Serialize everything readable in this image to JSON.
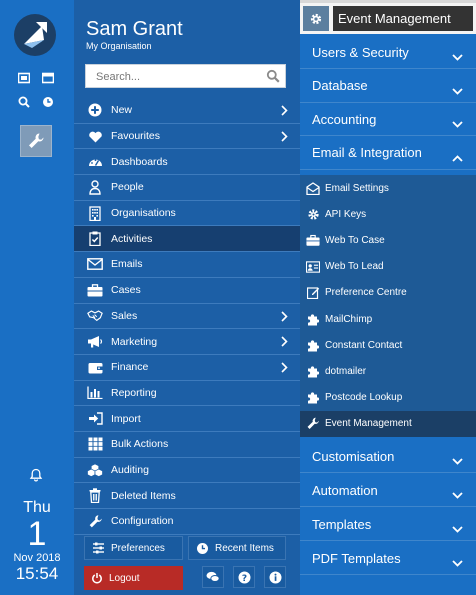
{
  "rail": {
    "icons": [
      "logo-icon",
      "card-icon",
      "window-icon",
      "search-icon",
      "history-icon",
      "wrench-icon",
      "bell-icon"
    ],
    "date": {
      "weekday": "Thu",
      "day": "1",
      "month_year": "Nov 2018",
      "time": "15:54"
    }
  },
  "user": {
    "name": "Sam Grant",
    "organisation": "My Organisation"
  },
  "search": {
    "placeholder": "Search..."
  },
  "menu": [
    {
      "label": "New",
      "icon": "plus-circle-icon",
      "chevron": true
    },
    {
      "label": "Favourites",
      "icon": "heart-icon",
      "chevron": true
    },
    {
      "label": "Dashboards",
      "icon": "dashboard-icon",
      "chevron": false
    },
    {
      "label": "People",
      "icon": "person-icon",
      "chevron": false
    },
    {
      "label": "Organisations",
      "icon": "building-icon",
      "chevron": false
    },
    {
      "label": "Activities",
      "icon": "clipboard-check-icon",
      "chevron": false,
      "active": true
    },
    {
      "label": "Emails",
      "icon": "envelope-icon",
      "chevron": false
    },
    {
      "label": "Cases",
      "icon": "briefcase-icon",
      "chevron": false
    },
    {
      "label": "Sales",
      "icon": "handshake-icon",
      "chevron": true
    },
    {
      "label": "Marketing",
      "icon": "megaphone-icon",
      "chevron": true
    },
    {
      "label": "Finance",
      "icon": "wallet-icon",
      "chevron": true
    },
    {
      "label": "Reporting",
      "icon": "bar-chart-icon",
      "chevron": false
    },
    {
      "label": "Import",
      "icon": "sign-in-icon",
      "chevron": false
    },
    {
      "label": "Bulk Actions",
      "icon": "grid-icon",
      "chevron": false
    },
    {
      "label": "Auditing",
      "icon": "cubes-icon",
      "chevron": false
    },
    {
      "label": "Deleted Items",
      "icon": "trash-icon",
      "chevron": false
    },
    {
      "label": "Configuration",
      "icon": "wrench-icon",
      "chevron": false
    }
  ],
  "bottom": {
    "preferences": "Preferences",
    "recent": "Recent Items",
    "logout": "Logout"
  },
  "dropdown": {
    "title": "Event Management",
    "sections_top": [
      "Users & Security",
      "Database",
      "Accounting",
      "Email & Integration"
    ],
    "sub_items": [
      {
        "label": "Email Settings",
        "icon": "envelope-open-icon"
      },
      {
        "label": "API Keys",
        "icon": "gear-icon"
      },
      {
        "label": "Web To Case",
        "icon": "briefcase-icon"
      },
      {
        "label": "Web To Lead",
        "icon": "id-card-icon"
      },
      {
        "label": "Preference Centre",
        "icon": "edit-icon"
      },
      {
        "label": "MailChimp",
        "icon": "puzzle-icon"
      },
      {
        "label": "Constant Contact",
        "icon": "puzzle-icon"
      },
      {
        "label": "dotmailer",
        "icon": "puzzle-icon"
      },
      {
        "label": "Postcode Lookup",
        "icon": "puzzle-icon"
      },
      {
        "label": "Event Management",
        "icon": "wrench-icon",
        "active": true
      }
    ],
    "sections_bottom": [
      "Customisation",
      "Automation",
      "Templates",
      "PDF Templates"
    ]
  },
  "colors": {
    "rail": "#1a6fc4",
    "panel": "#1c5fa6",
    "active": "#163f70",
    "logout": "#b82b26",
    "submenu": "#1e5a96"
  }
}
